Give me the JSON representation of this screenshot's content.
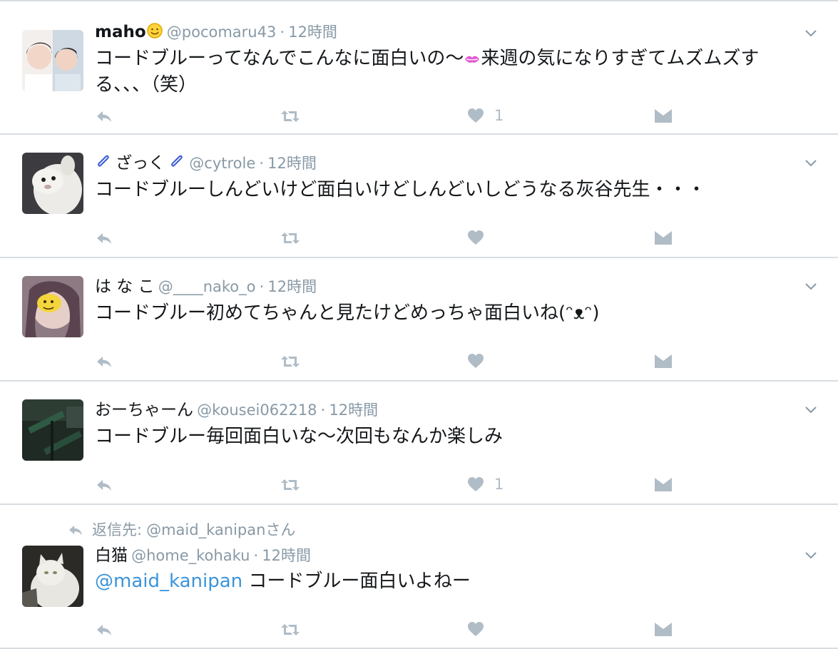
{
  "colors": {
    "muted": "#8899a6",
    "action": "#b0bcc6",
    "link": "#3b94d9",
    "text": "#14171a",
    "divider": "#d8dde2"
  },
  "tweets": [
    {
      "name": "maho",
      "name_emoji": "smiley-emoji",
      "handle": "@pocomaru43",
      "dot": "·",
      "time": "12時間",
      "text_a": "コードブルーってなんでこんなに面白いの〜",
      "text_emoji": "kiss-lips-emoji",
      "text_b": "来週の気になりすぎてムズムズする、、、（笑）",
      "like_count": "1"
    },
    {
      "name": "ざっく",
      "name_emoji": "paperclip-emoji",
      "handle": "@cytrole",
      "dot": "·",
      "time": "12時間",
      "text": "コードブルーしんどいけど面白いけどしんどいしどうなる灰谷先生・・・",
      "like_count": ""
    },
    {
      "name": "は な こ",
      "handle": "@____nako_o",
      "dot": "·",
      "time": "12時間",
      "text": "コードブルー初めてちゃんと見たけどめっちゃ面白いね(ᵔᴥᵔ)",
      "like_count": ""
    },
    {
      "name": "おーちゃーん",
      "handle": "@kousei062218",
      "dot": "·",
      "time": "12時間",
      "text": "コードブルー毎回面白いな〜次回もなんか楽しみ",
      "like_count": "1"
    },
    {
      "reply_label": "返信先:",
      "reply_to": "@maid_kanipanさん",
      "name": "白猫",
      "handle": "@home_kohaku",
      "dot": "·",
      "time": "12時間",
      "mention": "@maid_kanipan",
      "text": " コードブルー面白いよねー",
      "like_count": ""
    }
  ]
}
